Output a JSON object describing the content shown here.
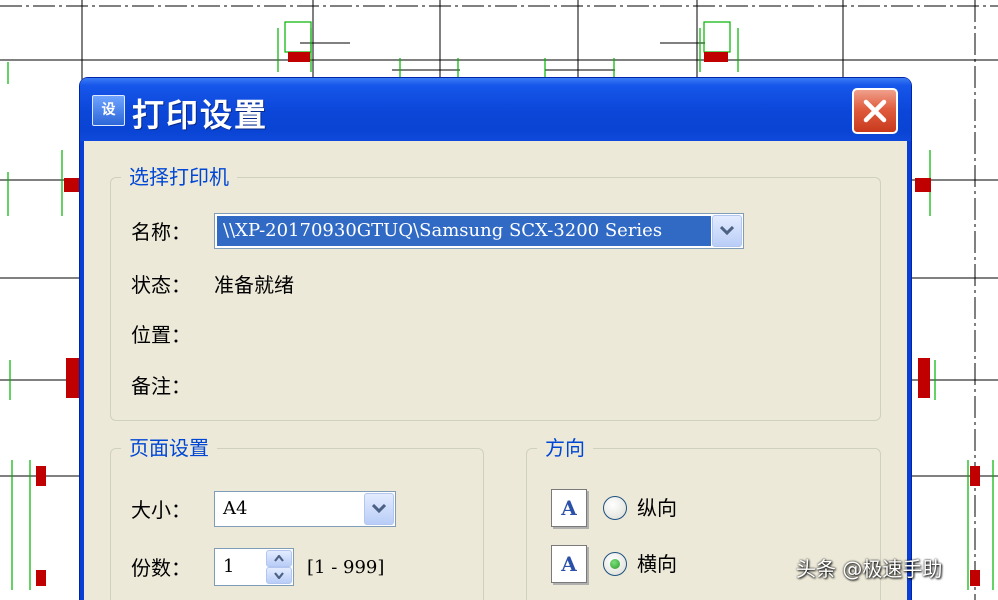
{
  "dialog": {
    "icon_label": "设",
    "title": "打印设置"
  },
  "printer_group": {
    "title": "选择打印机",
    "name_label": "名称：",
    "name_value": "\\\\XP-20170930GTUQ\\Samsung SCX-3200 Series",
    "status_label": "状态：",
    "status_value": "准备就绪",
    "location_label": "位置：",
    "comment_label": "备注："
  },
  "page_group": {
    "title": "页面设置",
    "size_label": "大小：",
    "size_value": "A4",
    "copies_label": "份数：",
    "copies_value": "1",
    "copies_range": "[1 - 999]"
  },
  "orientation_group": {
    "title": "方向",
    "page_icon_letter": "A",
    "portrait_label": "纵向",
    "landscape_label": "横向",
    "selected": "landscape"
  },
  "watermark": "头条 @极速手助",
  "colors": {
    "title_bar": "#0a44d4",
    "dialog_bg": "#ece9d8",
    "group_title": "#0046d5",
    "selection": "#316ac5",
    "close_button": "#e05d3e",
    "cad_green": "#00b400",
    "cad_red": "#c00000"
  }
}
